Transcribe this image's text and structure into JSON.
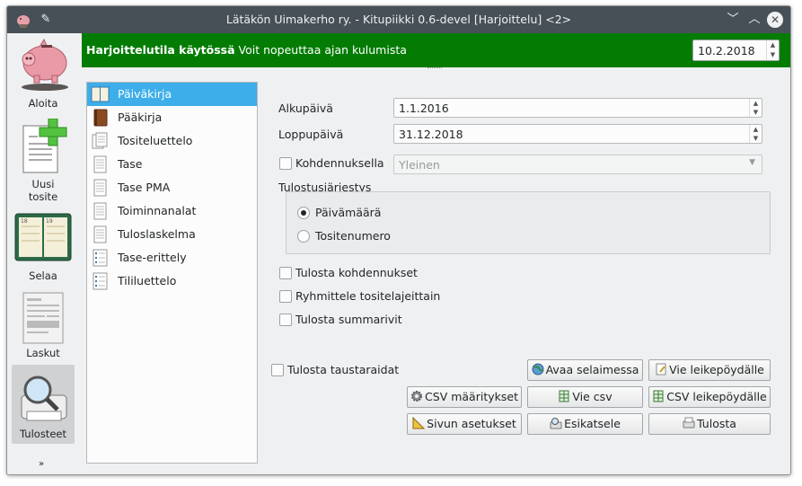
{
  "window": {
    "title": "Lätäkön Uimakerho ry. - Kitupiikki 0.6-devel [Harjoittelu] <2>"
  },
  "titlebar_icons": [
    "app-icon",
    "pin-icon",
    "minimize-icon",
    "maximize-icon",
    "close-icon"
  ],
  "sidebar": {
    "items": [
      {
        "label": "Aloita",
        "icon": "piggy-bank-icon"
      },
      {
        "label": "Uusi\ntosite",
        "icon": "new-document-icon"
      },
      {
        "label": "Selaa",
        "icon": "ledger-book-icon"
      },
      {
        "label": "Laskut",
        "icon": "invoice-icon"
      },
      {
        "label": "Tulosteet",
        "icon": "print-preview-icon"
      }
    ],
    "more": "»",
    "active": "Tulosteet"
  },
  "banner": {
    "bold": "Harjoittelutila käytössä",
    "text": " Voit nopeuttaa ajan kulumista",
    "date": "10.2.2018",
    "color": "#047c04"
  },
  "reports": {
    "items": [
      {
        "label": "Päiväkirja",
        "icon": "open-book-icon",
        "selected": true
      },
      {
        "label": "Pääkirja",
        "icon": "brown-book-icon"
      },
      {
        "label": "Tositeluettelo",
        "icon": "documents-icon"
      },
      {
        "label": "Tase",
        "icon": "document-icon"
      },
      {
        "label": "Tase PMA",
        "icon": "document-icon"
      },
      {
        "label": "Toiminnanalat",
        "icon": "document-icon"
      },
      {
        "label": "Tuloslaskelma",
        "icon": "document-icon"
      },
      {
        "label": "Tase-erittely",
        "icon": "list-document-icon"
      },
      {
        "label": "Tililuettelo",
        "icon": "list-document-icon"
      }
    ]
  },
  "form": {
    "start_label": "Alkupäivä",
    "start_value": "1.1.2016",
    "end_label": "Loppupäivä",
    "end_value": "31.12.2018",
    "allocation_label": "Kohdennuksella",
    "allocation_value": "Yleinen",
    "order_label": "Tulostusjärjestys",
    "order_date": "Päivämäärä",
    "order_number": "Tositenumero",
    "opt_print_allocations": "Tulosta kohdennukset",
    "opt_group_types": "Ryhmittele tositelajeittain",
    "opt_summary_rows": "Tulosta summarivit",
    "opt_background_stripes": "Tulosta taustaraidat"
  },
  "buttons": {
    "open_browser": "Avaa selaimessa",
    "copy_clipboard": "Vie leikepöydälle",
    "csv_settings": "CSV määritykset",
    "export_csv": "Vie csv",
    "csv_clipboard": "CSV leikepöydälle",
    "page_settings": "Sivun asetukset",
    "preview": "Esikatsele",
    "print": "Tulosta"
  },
  "colors": {
    "accent": "#3daee9",
    "titlebar": "#475057"
  }
}
